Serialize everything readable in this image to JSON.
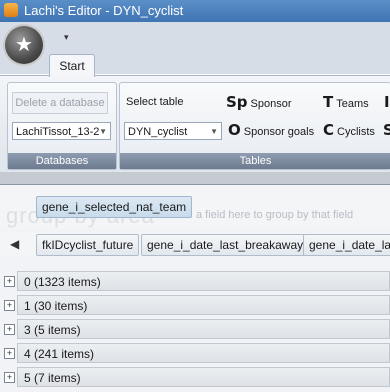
{
  "window": {
    "title": "Lachi's Editor - DYN_cyclist"
  },
  "quick_access": {
    "dropdown_glyph": "▾"
  },
  "ribbon": {
    "tabs": [
      {
        "label": "Start"
      }
    ],
    "databases": {
      "delete_label": "Delete a database",
      "selected_db": "LachiTissot_13-2",
      "group_label": "Databases"
    },
    "tables": {
      "select_label": "Select table",
      "selected_table": "DYN_cyclist",
      "group_label": "Tables",
      "commands": [
        {
          "glyph": "Sp",
          "label": "Sponsor"
        },
        {
          "glyph": "T",
          "label": "Teams"
        },
        {
          "glyph": "O",
          "label": "Sponsor goals"
        },
        {
          "glyph": "C",
          "label": "Cyclists"
        },
        {
          "glyph": "I",
          "label": ""
        },
        {
          "glyph": "S",
          "label": ""
        }
      ]
    }
  },
  "grid": {
    "group_panel": {
      "watermark": "group by area",
      "hint": "a field here to group by that field",
      "grouped_column": "gene_i_selected_nat_team"
    },
    "columns": [
      "fkIDcyclist_future",
      "gene_i_date_last_breakaway",
      "gene_i_date_las"
    ],
    "groups": [
      {
        "text": "0 (1323 items)"
      },
      {
        "text": "1 (30 items)"
      },
      {
        "text": "3 (5 items)"
      },
      {
        "text": "4 (241 items)"
      },
      {
        "text": "5 (7 items)"
      }
    ]
  }
}
